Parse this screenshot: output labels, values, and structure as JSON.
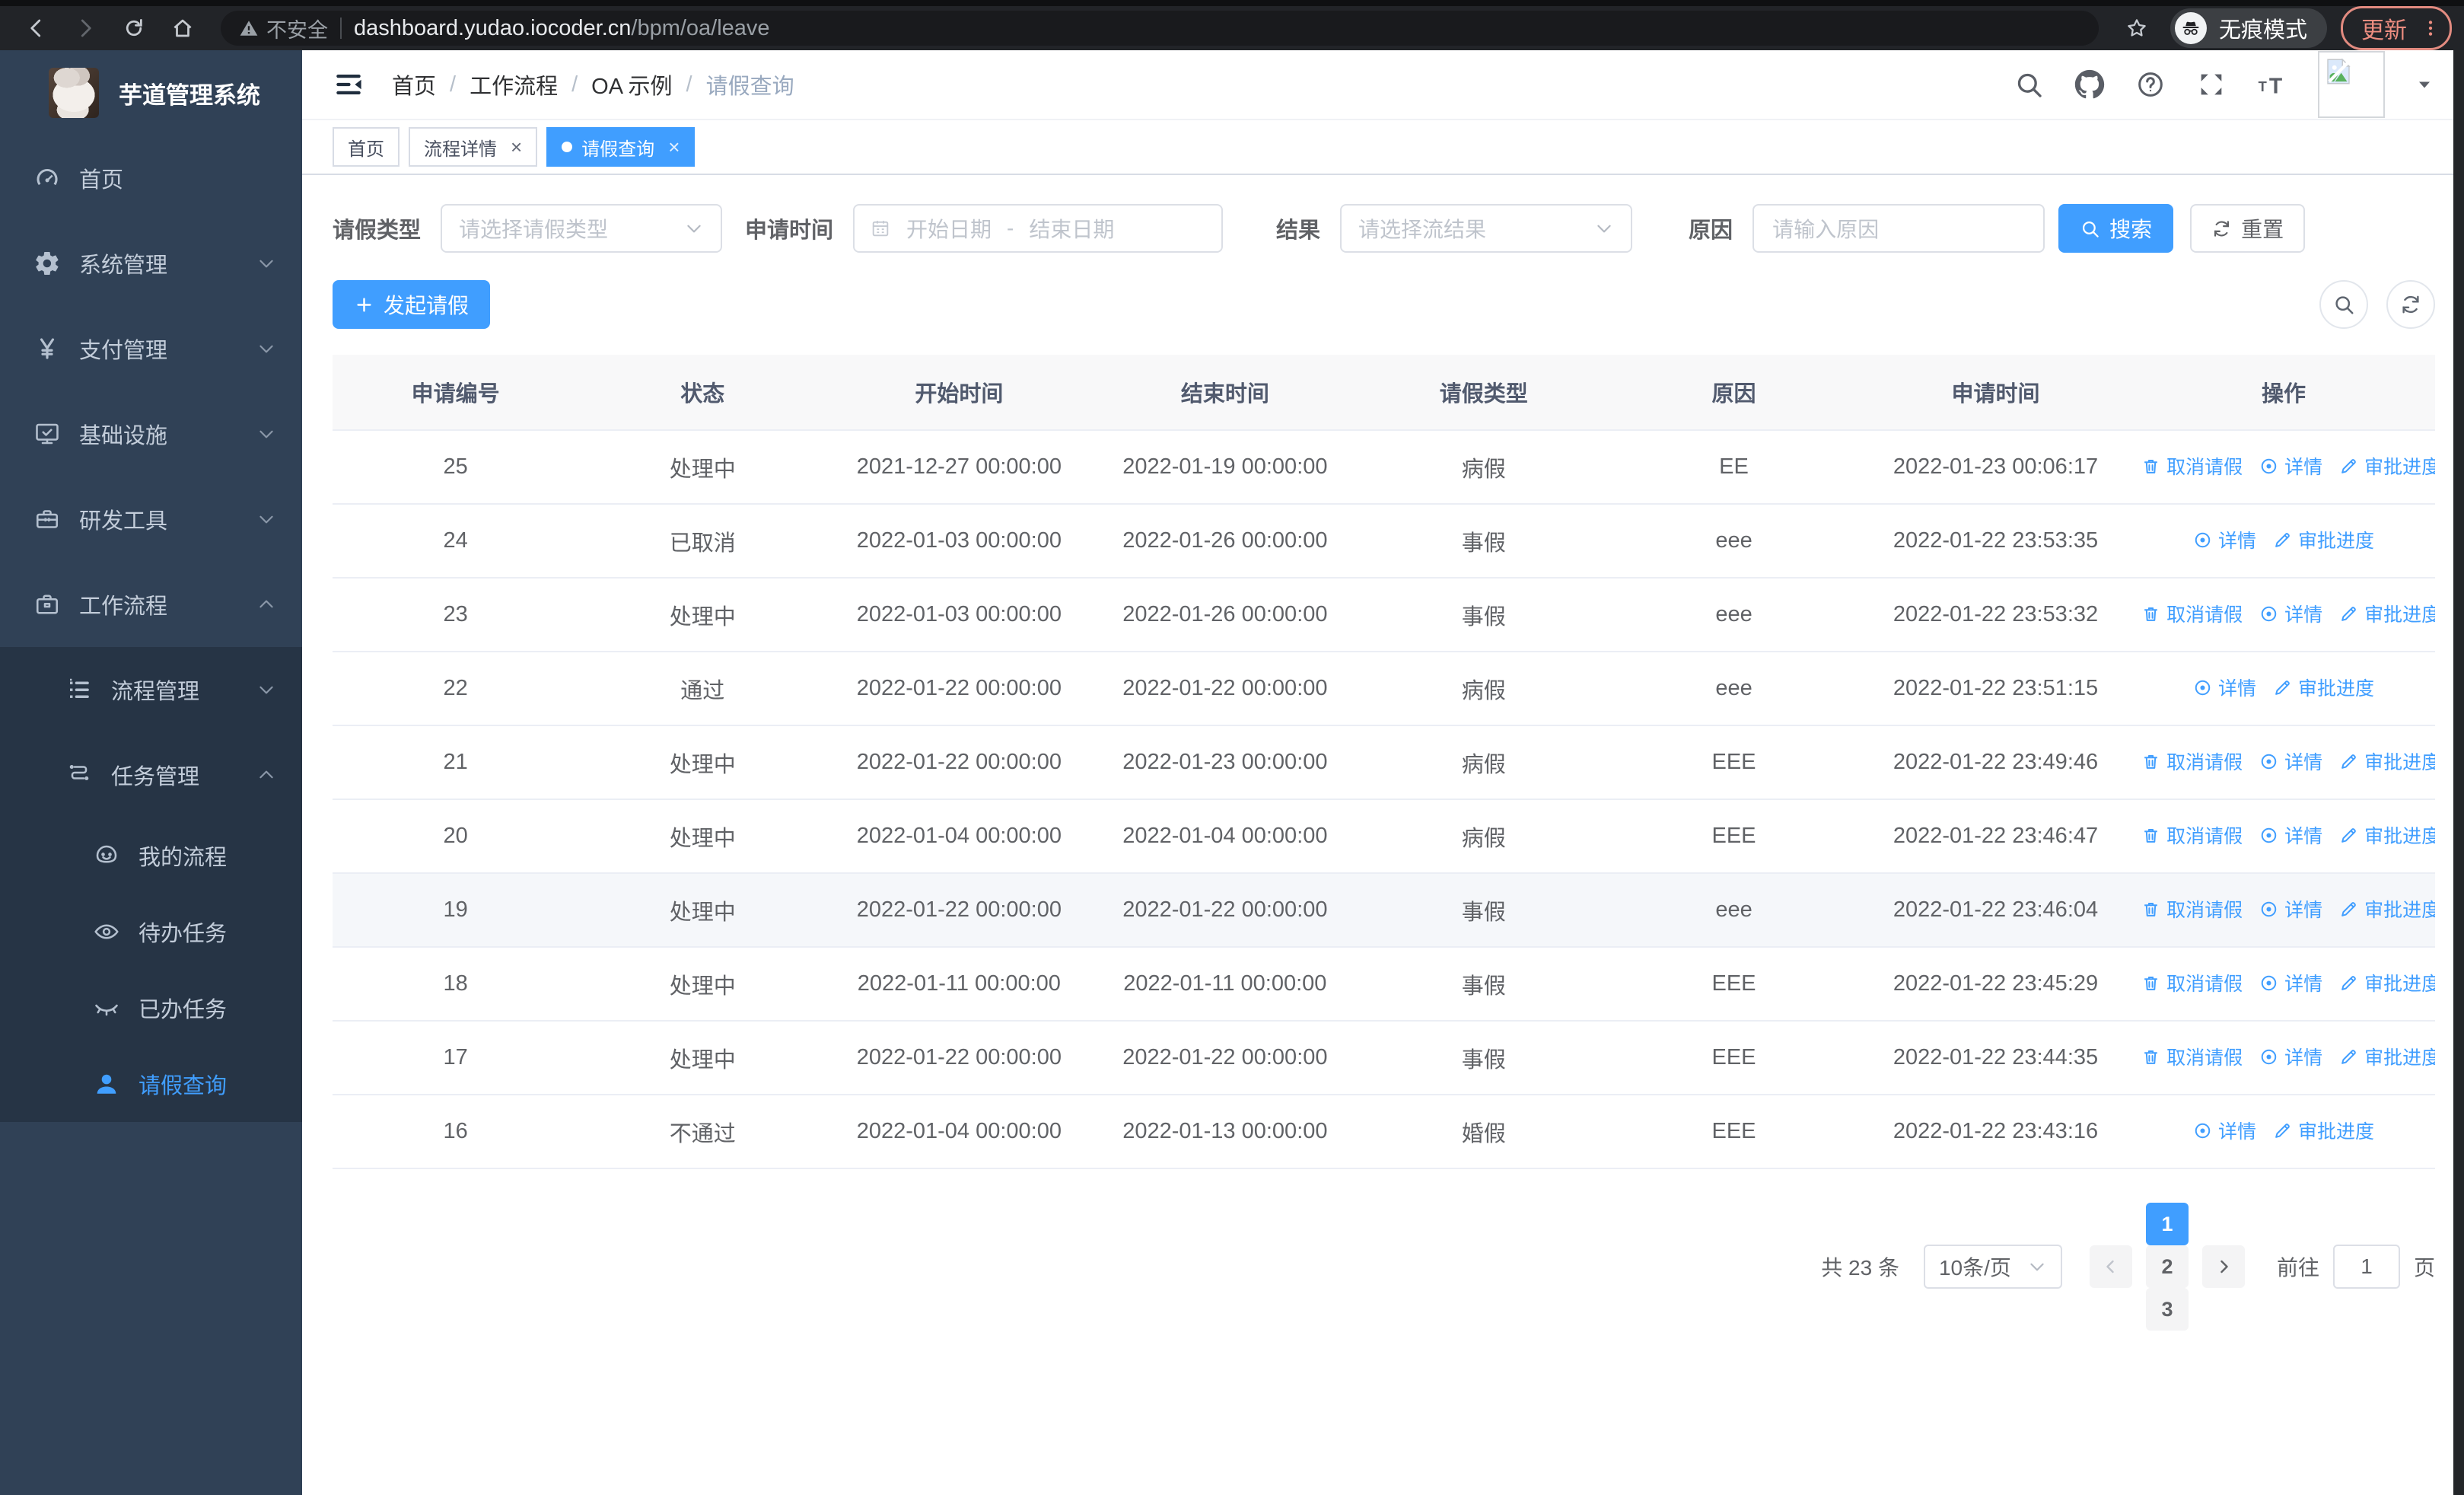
{
  "colors": {
    "accent": "#409eff",
    "sidebar_bg": "#304156",
    "submenu_bg": "#263445"
  },
  "browser": {
    "security_text": "不安全",
    "url_host": "dashboard.yudao.iocoder.cn",
    "url_path": "/bpm/oa/leave",
    "incognito_label": "无痕模式",
    "update_label": "更新"
  },
  "sidebar": {
    "title": "芋道管理系统",
    "menu": [
      {
        "name": "home",
        "label": "首页",
        "icon": "dashboard-icon",
        "level": 1
      },
      {
        "name": "system-management",
        "label": "系统管理",
        "icon": "gear-icon",
        "level": 1,
        "chevron": "down"
      },
      {
        "name": "payment-management",
        "label": "支付管理",
        "icon": "yen-icon",
        "level": 1,
        "chevron": "down"
      },
      {
        "name": "infrastructure",
        "label": "基础设施",
        "icon": "monitor-icon",
        "level": 1,
        "chevron": "down"
      },
      {
        "name": "dev-tools",
        "label": "研发工具",
        "icon": "toolbox-icon",
        "level": 1,
        "chevron": "down"
      },
      {
        "name": "workflow",
        "label": "工作流程",
        "icon": "briefcase-icon",
        "level": 1,
        "chevron": "up"
      },
      {
        "name": "process-management",
        "label": "流程管理",
        "icon": "list-icon",
        "level": 2,
        "chevron": "down",
        "in_expanded": true
      },
      {
        "name": "task-management",
        "label": "任务管理",
        "icon": "tree-icon",
        "level": 2,
        "chevron": "up",
        "in_expanded": true
      },
      {
        "name": "my-process",
        "label": "我的流程",
        "icon": "face-icon",
        "level": 3,
        "in_expanded": true
      },
      {
        "name": "todo-tasks",
        "label": "待办任务",
        "icon": "eye-icon",
        "level": 3,
        "in_expanded": true
      },
      {
        "name": "done-tasks",
        "label": "已办任务",
        "icon": "eye-closed-icon",
        "level": 3,
        "in_expanded": true
      },
      {
        "name": "leave-query",
        "label": "请假查询",
        "icon": "user-icon",
        "level": 3,
        "in_expanded": true,
        "active": true
      }
    ]
  },
  "navbar": {
    "breadcrumb": [
      "首页",
      "工作流程",
      "OA 示例",
      "请假查询"
    ]
  },
  "tabs": [
    {
      "name": "home",
      "label": "首页",
      "active": false,
      "closable": false
    },
    {
      "name": "process-detail",
      "label": "流程详情",
      "active": false,
      "closable": true
    },
    {
      "name": "leave-query",
      "label": "请假查询",
      "active": true,
      "closable": true
    }
  ],
  "filters": {
    "leave_type_label": "请假类型",
    "leave_type_placeholder": "请选择请假类型",
    "apply_time_label": "申请时间",
    "start_placeholder": "开始日期",
    "range_separator": "-",
    "end_placeholder": "结束日期",
    "result_label": "结果",
    "result_placeholder": "请选择流结果",
    "reason_label": "原因",
    "reason_placeholder": "请输入原因",
    "search_label": "搜索",
    "reset_label": "重置"
  },
  "toolbar": {
    "create_label": "发起请假"
  },
  "table": {
    "columns": [
      {
        "key": "id",
        "label": "申请编号",
        "width": "11.7%"
      },
      {
        "key": "status",
        "label": "状态",
        "width": "11.8%"
      },
      {
        "key": "start",
        "label": "开始时间",
        "width": "12.6%"
      },
      {
        "key": "end",
        "label": "结束时间",
        "width": "12.7%"
      },
      {
        "key": "type",
        "label": "请假类型",
        "width": "11.9%"
      },
      {
        "key": "reason",
        "label": "原因",
        "width": "11.9%"
      },
      {
        "key": "apply_time",
        "label": "申请时间",
        "width": "13.0%"
      },
      {
        "key": "actions",
        "label": "操作",
        "width": "14.4%"
      }
    ],
    "action_defs": {
      "cancel": {
        "label": "取消请假",
        "icon": "trash-icon",
        "name": "cancel-leave-link"
      },
      "detail": {
        "label": "详情",
        "icon": "view-icon",
        "name": "detail-link"
      },
      "progress": {
        "label": "审批进度",
        "icon": "edit-icon",
        "name": "approval-progress-link"
      }
    },
    "rows": [
      {
        "id": "25",
        "status": "处理中",
        "start": "2021-12-27 00:00:00",
        "end": "2022-01-19 00:00:00",
        "type": "病假",
        "reason": "EE",
        "apply_time": "2022-01-23 00:06:17",
        "actions": [
          "cancel",
          "detail",
          "progress"
        ]
      },
      {
        "id": "24",
        "status": "已取消",
        "start": "2022-01-03 00:00:00",
        "end": "2022-01-26 00:00:00",
        "type": "事假",
        "reason": "eee",
        "apply_time": "2022-01-22 23:53:35",
        "actions": [
          "detail",
          "progress"
        ]
      },
      {
        "id": "23",
        "status": "处理中",
        "start": "2022-01-03 00:00:00",
        "end": "2022-01-26 00:00:00",
        "type": "事假",
        "reason": "eee",
        "apply_time": "2022-01-22 23:53:32",
        "actions": [
          "cancel",
          "detail",
          "progress"
        ]
      },
      {
        "id": "22",
        "status": "通过",
        "start": "2022-01-22 00:00:00",
        "end": "2022-01-22 00:00:00",
        "type": "病假",
        "reason": "eee",
        "apply_time": "2022-01-22 23:51:15",
        "actions": [
          "detail",
          "progress"
        ]
      },
      {
        "id": "21",
        "status": "处理中",
        "start": "2022-01-22 00:00:00",
        "end": "2022-01-23 00:00:00",
        "type": "病假",
        "reason": "EEE",
        "apply_time": "2022-01-22 23:49:46",
        "actions": [
          "cancel",
          "detail",
          "progress"
        ]
      },
      {
        "id": "20",
        "status": "处理中",
        "start": "2022-01-04 00:00:00",
        "end": "2022-01-04 00:00:00",
        "type": "病假",
        "reason": "EEE",
        "apply_time": "2022-01-22 23:46:47",
        "actions": [
          "cancel",
          "detail",
          "progress"
        ]
      },
      {
        "id": "19",
        "status": "处理中",
        "start": "2022-01-22 00:00:00",
        "end": "2022-01-22 00:00:00",
        "type": "事假",
        "reason": "eee",
        "apply_time": "2022-01-22 23:46:04",
        "actions": [
          "cancel",
          "detail",
          "progress"
        ],
        "hover": true
      },
      {
        "id": "18",
        "status": "处理中",
        "start": "2022-01-11 00:00:00",
        "end": "2022-01-11 00:00:00",
        "type": "事假",
        "reason": "EEE",
        "apply_time": "2022-01-22 23:45:29",
        "actions": [
          "cancel",
          "detail",
          "progress"
        ]
      },
      {
        "id": "17",
        "status": "处理中",
        "start": "2022-01-22 00:00:00",
        "end": "2022-01-22 00:00:00",
        "type": "事假",
        "reason": "EEE",
        "apply_time": "2022-01-22 23:44:35",
        "actions": [
          "cancel",
          "detail",
          "progress"
        ]
      },
      {
        "id": "16",
        "status": "不通过",
        "start": "2022-01-04 00:00:00",
        "end": "2022-01-13 00:00:00",
        "type": "婚假",
        "reason": "EEE",
        "apply_time": "2022-01-22 23:43:16",
        "actions": [
          "detail",
          "progress"
        ]
      }
    ]
  },
  "pagination": {
    "total_text": "共 23 条",
    "page_size": "10条/页",
    "pages": [
      {
        "label": "1",
        "active": true
      },
      {
        "label": "2",
        "active": false
      },
      {
        "label": "3",
        "active": false
      }
    ],
    "goto_label": "前往",
    "goto_value": "1",
    "goto_suffix": "页"
  }
}
